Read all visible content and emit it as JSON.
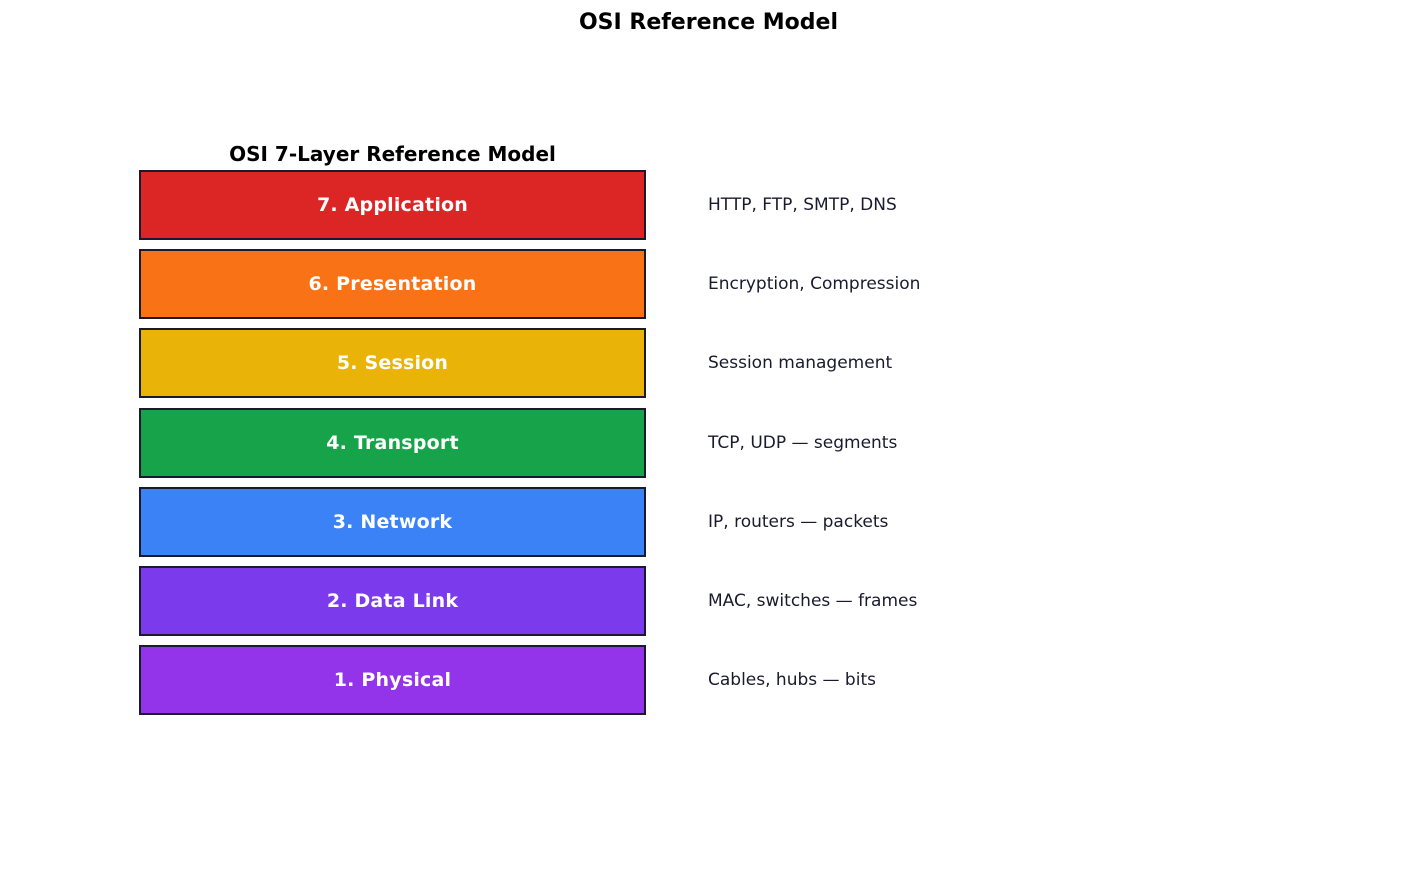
{
  "page": {
    "title": "OSI Reference Model"
  },
  "diagram": {
    "title": "OSI 7-Layer Reference Model",
    "layers": [
      {
        "label": "7. Application",
        "description": "HTTP, FTP, SMTP, DNS",
        "color": "#dc2626"
      },
      {
        "label": "6. Presentation",
        "description": "Encryption, Compression",
        "color": "#f97316"
      },
      {
        "label": "5. Session",
        "description": "Session management",
        "color": "#eab308"
      },
      {
        "label": "4. Transport",
        "description": "TCP, UDP — segments",
        "color": "#16a34a"
      },
      {
        "label": "3. Network",
        "description": "IP, routers — packets",
        "color": "#3b82f6"
      },
      {
        "label": "2. Data Link",
        "description": "MAC, switches — frames",
        "color": "#7c3aed"
      },
      {
        "label": "1. Physical",
        "description": "Cables, hubs — bits",
        "color": "#9333ea"
      }
    ],
    "border_color": "#1a1a2e",
    "label_color": "#ffffff",
    "description_color": "#1a1a2e"
  }
}
